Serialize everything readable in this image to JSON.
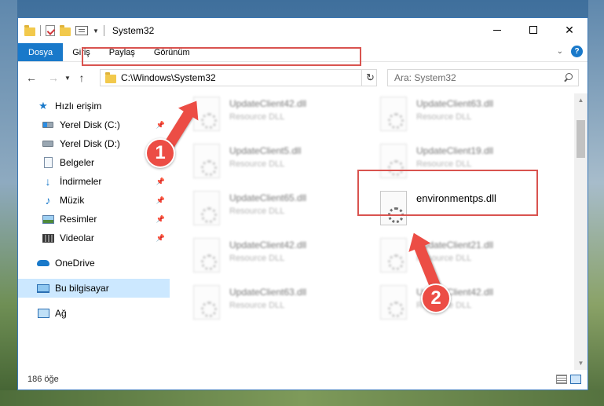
{
  "window": {
    "title": "System32",
    "icons": [
      "folder-icon",
      "checkmark-properties-icon",
      "new-folder-icon",
      "properties-icon"
    ]
  },
  "ribbon": {
    "tabs": [
      "Dosya",
      "Giriş",
      "Paylaş",
      "Görünüm"
    ],
    "accent": "#1979ca"
  },
  "nav": {
    "address": "C:\\Windows\\System32",
    "search_placeholder": "Ara: System32"
  },
  "sidebar": {
    "items": [
      {
        "label": "Hızlı erişim",
        "icon": "star-icon"
      },
      {
        "label": "Yerel Disk (C:)",
        "icon": "drive-icon"
      },
      {
        "label": "Yerel Disk (D:)",
        "icon": "drive-icon"
      },
      {
        "label": "Belgeler",
        "icon": "document-icon"
      },
      {
        "label": "İndirmeler",
        "icon": "download-icon"
      },
      {
        "label": "Müzik",
        "icon": "music-icon"
      },
      {
        "label": "Resimler",
        "icon": "pictures-icon"
      },
      {
        "label": "Videolar",
        "icon": "videos-icon"
      },
      {
        "label": "OneDrive",
        "icon": "cloud-icon"
      },
      {
        "label": "Bu bilgisayar",
        "icon": "computer-icon"
      },
      {
        "label": "Ağ",
        "icon": "network-icon"
      }
    ]
  },
  "files": [
    {
      "name": "UpdateClient42.dll",
      "desc": "Resource DLL"
    },
    {
      "name": "UpdateClient63.dll",
      "desc": "Resource DLL"
    },
    {
      "name": "UpdateClient5.dll",
      "desc": "Resource DLL"
    },
    {
      "name": "UpdateClient19.dll",
      "desc": "Resource DLL"
    },
    {
      "name": "UpdateClient65.dll",
      "desc": "Resource DLL"
    },
    {
      "name": "environmentps.dll",
      "desc": ""
    },
    {
      "name": "UpdateClient42.dll",
      "desc": "Resource DLL"
    },
    {
      "name": "UpdateClient21.dll",
      "desc": "Resource DLL"
    },
    {
      "name": "UpdateClient63.dll",
      "desc": "Resource DLL"
    },
    {
      "name": "UpdateClient42.dll",
      "desc": "Resource DLL"
    }
  ],
  "status": {
    "count": "186 öğe"
  },
  "callouts": {
    "step1": "1",
    "step2": "2",
    "color": "#ec4d45"
  }
}
